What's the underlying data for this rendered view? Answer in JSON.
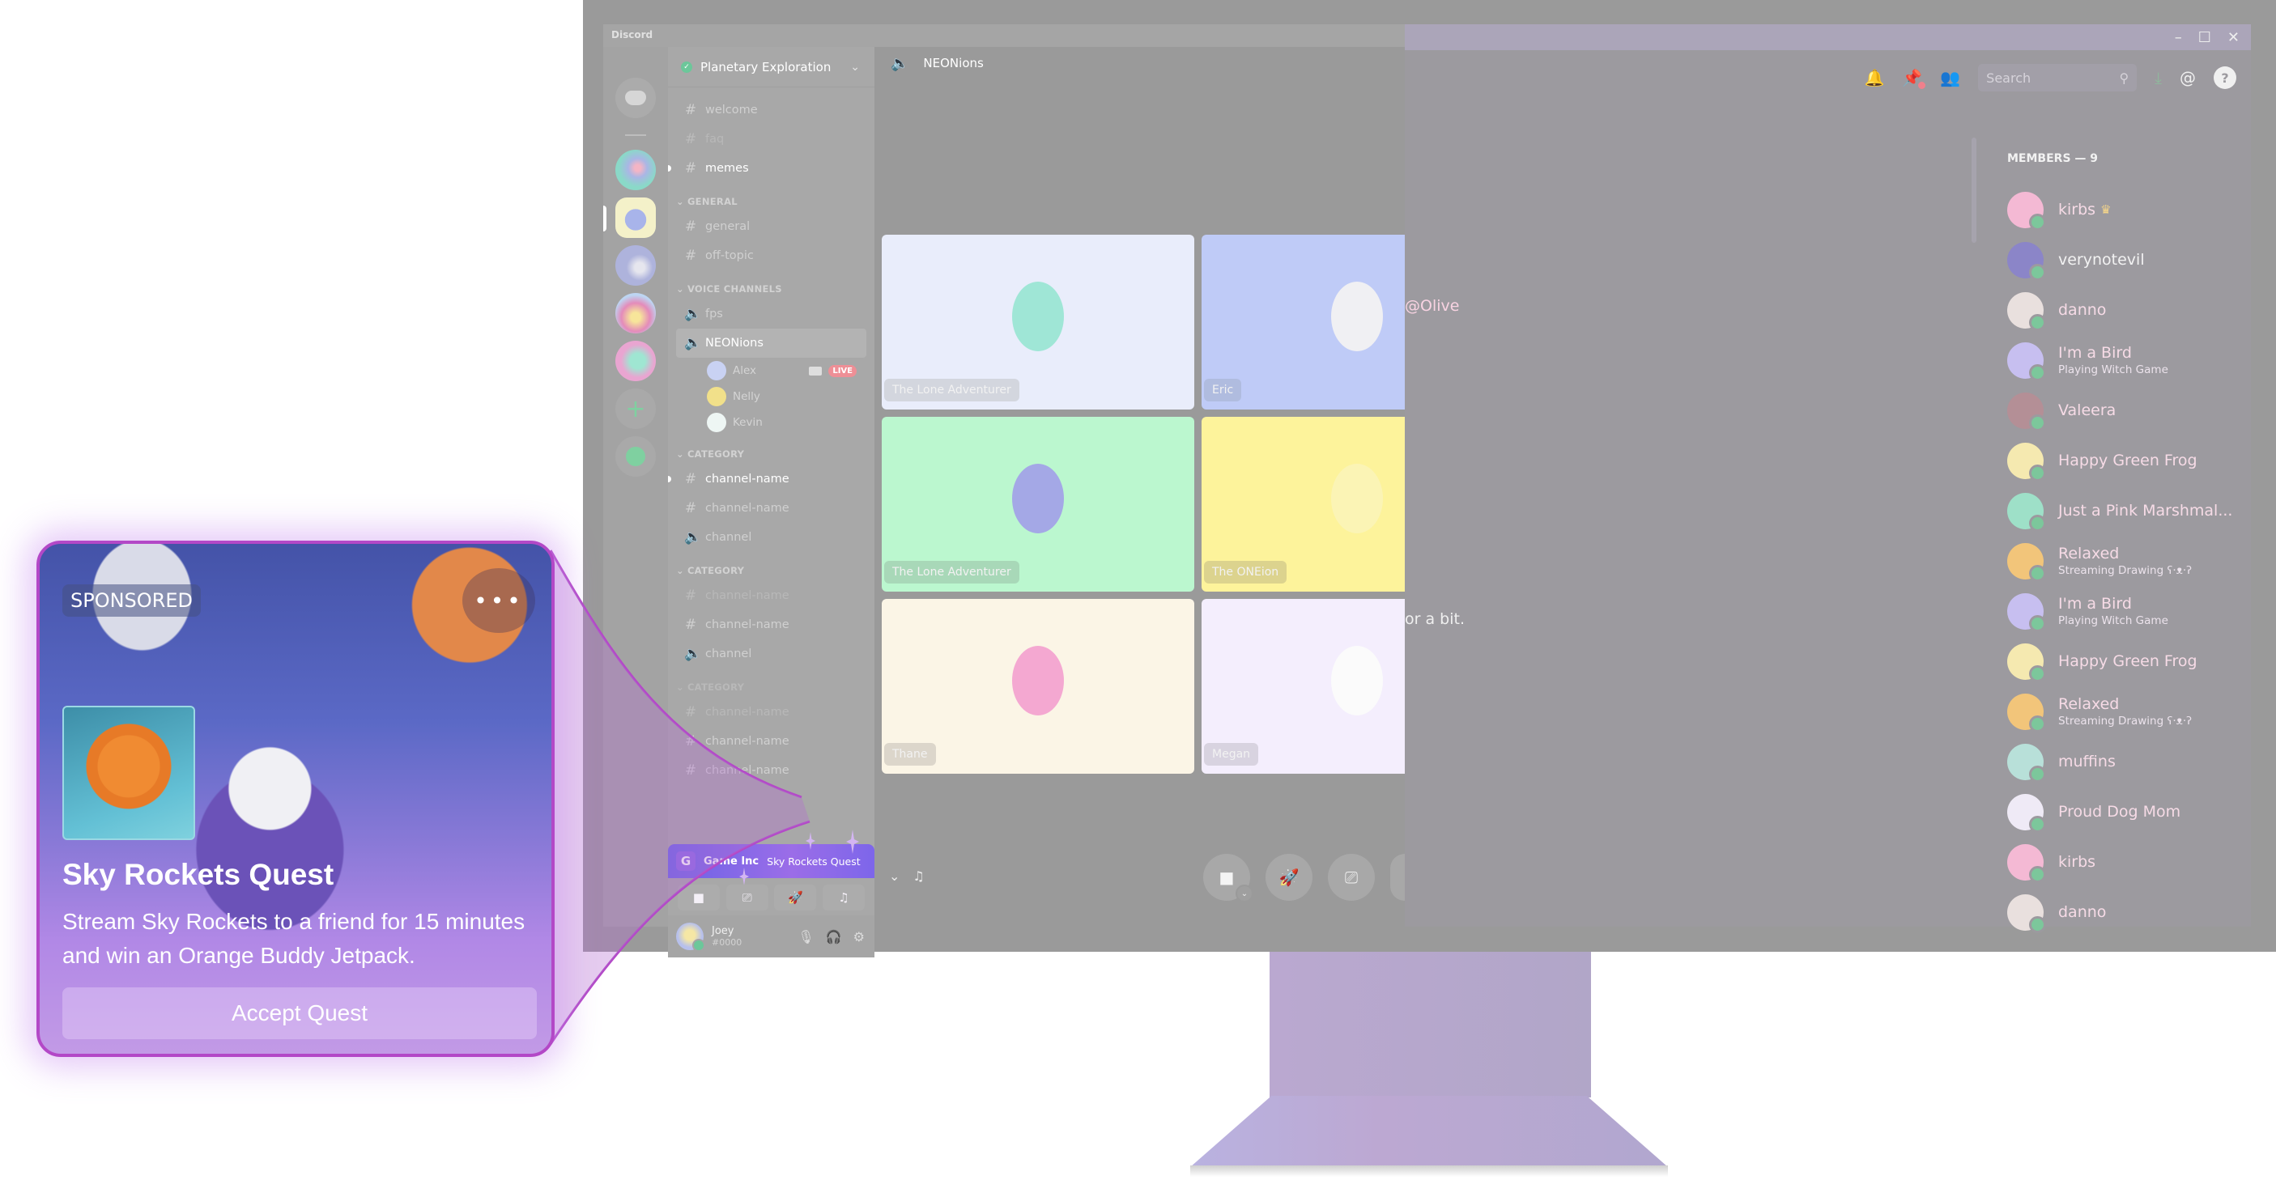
{
  "app": {
    "brand": "Discord",
    "window_controls": {
      "minimize": "–",
      "maximize": "☐",
      "close": "✕"
    }
  },
  "servers": [
    {
      "name": "discord-home",
      "icon": "discord-logo-icon"
    },
    {
      "name": "server-1"
    },
    {
      "name": "server-2",
      "selected": true
    },
    {
      "name": "server-3"
    },
    {
      "name": "server-4"
    },
    {
      "name": "server-5"
    },
    {
      "name": "add-server",
      "icon_glyph": "+"
    },
    {
      "name": "explore-servers",
      "icon": "compass-icon"
    }
  ],
  "guild": {
    "name": "Planetary Exploration",
    "verified_glyph": "✓",
    "chevron_glyph": "⌄"
  },
  "channels": {
    "top": [
      {
        "type": "text",
        "name": "welcome",
        "glyph": "#"
      },
      {
        "type": "text",
        "name": "faq",
        "glyph": "#"
      },
      {
        "type": "text",
        "name": "memes",
        "glyph": "#"
      }
    ],
    "general": {
      "label": "GENERAL",
      "items": [
        {
          "type": "text",
          "name": "general",
          "glyph": "#"
        },
        {
          "type": "text",
          "name": "off-topic",
          "glyph": "#"
        }
      ]
    },
    "voice": {
      "label": "VOICE CHANNELS",
      "items": [
        {
          "type": "voice",
          "name": "fps",
          "glyph": "🔈"
        },
        {
          "type": "voice",
          "name": "NEONions",
          "glyph": "🔈"
        }
      ],
      "users": [
        {
          "name": "Alex",
          "live": "LIVE"
        },
        {
          "name": "Nelly"
        },
        {
          "name": "Kevin"
        }
      ]
    },
    "category1": {
      "label": "CATEGORY",
      "items": [
        {
          "type": "text",
          "name": "channel-name",
          "glyph": "#"
        },
        {
          "type": "text",
          "name": "channel-name",
          "glyph": "#"
        },
        {
          "type": "voice",
          "name": "channel",
          "glyph": "🔈"
        }
      ]
    },
    "category2": {
      "label": "CATEGORY",
      "items": [
        {
          "type": "text",
          "name": "channel-name",
          "glyph": "#"
        },
        {
          "type": "text",
          "name": "channel-name",
          "glyph": "#"
        },
        {
          "type": "voice",
          "name": "channel",
          "glyph": "🔈"
        }
      ]
    },
    "category3": {
      "label": "CATEGORY",
      "items": [
        {
          "type": "text",
          "name": "channel-name",
          "glyph": "#"
        },
        {
          "type": "text",
          "name": "channel-name",
          "glyph": "#"
        },
        {
          "type": "text",
          "name": "channel-name",
          "glyph": "#"
        }
      ]
    }
  },
  "quest_banner": {
    "logo_glyph": "G",
    "brand": "Game Inc",
    "title": "Sky Rockets Quest"
  },
  "activity_buttons": [
    {
      "name": "camera",
      "glyph": "■"
    },
    {
      "name": "share-screen",
      "glyph": "⎚"
    },
    {
      "name": "activities",
      "glyph": "🚀"
    },
    {
      "name": "soundboard",
      "glyph": "♫"
    }
  ],
  "user": {
    "name": "Joey",
    "tag": "#0000",
    "controls": {
      "mic": "🎙",
      "headphones": "🎧",
      "settings": "⚙"
    }
  },
  "voice_call": {
    "channel_name": "NEONions",
    "speaker_glyph": "🔈",
    "participants": [
      {
        "name": "The Lone Adventurer",
        "tile_color": "#e9edfb",
        "label_bg": "#d3d6de",
        "avatar_color": "#9fe6d6"
      },
      {
        "name": "Eric",
        "tile_color": "#bfcbf7",
        "label_bg": "#b0bcdf",
        "avatar_color": "#f0f0f3"
      },
      {
        "name": "The Lone Adventurer",
        "tile_color": "#bbf7cf",
        "label_bg": "#a8d8b8",
        "avatar_color": "#a4a8e6"
      },
      {
        "name": "The ONEion",
        "tile_color": "#fdf39b",
        "label_bg": "#dcd38e",
        "avatar_color": "#fbf4b5"
      },
      {
        "name": "Thane",
        "tile_color": "#fbf5e6",
        "label_bg": "#dcd6cb",
        "avatar_color": "#f4a8d1"
      },
      {
        "name": "Megan",
        "tile_color": "#f4eefd",
        "label_bg": "#d8d3e0",
        "avatar_color": "#fbfbfb"
      }
    ],
    "footer_left": {
      "collapse_glyph": "⌄",
      "soundboard_glyph": "♫"
    },
    "controls": [
      {
        "name": "camera",
        "glyph": "■",
        "has_menu": true,
        "menu_glyph": "⌄"
      },
      {
        "name": "activities",
        "glyph": "🚀"
      },
      {
        "name": "share-screen",
        "glyph": "⎚"
      }
    ]
  },
  "toolbar": {
    "search_placeholder": "Search",
    "search_glyph": "⚲",
    "icons": {
      "notifications": "🔔",
      "pins": "📌",
      "members": "👥",
      "download": "⤓",
      "mentions": "@",
      "help": "?"
    }
  },
  "chat_fragments": {
    "mention": "@Olive",
    "message_end": "or a bit."
  },
  "members": {
    "header": "MEMBERS — 9",
    "list": [
      {
        "name": "kirbs",
        "owner": true,
        "crown_glyph": "♛",
        "avatar_color": "#f4b9d4"
      },
      {
        "name": "verynotevil",
        "avatar_color": "#8b85c8",
        "white": true
      },
      {
        "name": "danno",
        "avatar_color": "#e9e0de"
      },
      {
        "name": "I'm a Bird",
        "status": "Playing Witch Game",
        "avatar_color": "#c7bff0"
      },
      {
        "name": "Valeera",
        "avatar_color": "#b48f96"
      },
      {
        "name": "Happy Green Frog",
        "avatar_color": "#f5e9b0"
      },
      {
        "name": "Just a Pink Marshmal...",
        "avatar_color": "#9ee0c8"
      },
      {
        "name": "Relaxed",
        "status": "Streaming Drawing ʕ·ᴥ·ʔ",
        "avatar_color": "#f2c57a"
      },
      {
        "name": "I'm a Bird",
        "status": "Playing Witch Game",
        "avatar_color": "#c7bff0"
      },
      {
        "name": "Happy Green Frog",
        "avatar_color": "#f5e9b0"
      },
      {
        "name": "Relaxed",
        "status": "Streaming Drawing ʕ·ᴥ·ʔ",
        "avatar_color": "#f2c57a"
      },
      {
        "name": "muffins",
        "avatar_color": "#b8e0d9"
      },
      {
        "name": "Proud Dog Mom",
        "avatar_color": "#efeaf6"
      },
      {
        "name": "kirbs",
        "avatar_color": "#f4b9d4"
      },
      {
        "name": "danno",
        "avatar_color": "#e9e0de"
      }
    ]
  },
  "quest_card": {
    "badge": "SPONSORED",
    "more_glyph": "•••",
    "title": "Sky Rockets Quest",
    "description": "Stream Sky Rockets to a friend for 15 minutes and win an Orange Buddy Jetpack.",
    "button": "Accept Quest",
    "accent": "#b348c7"
  }
}
